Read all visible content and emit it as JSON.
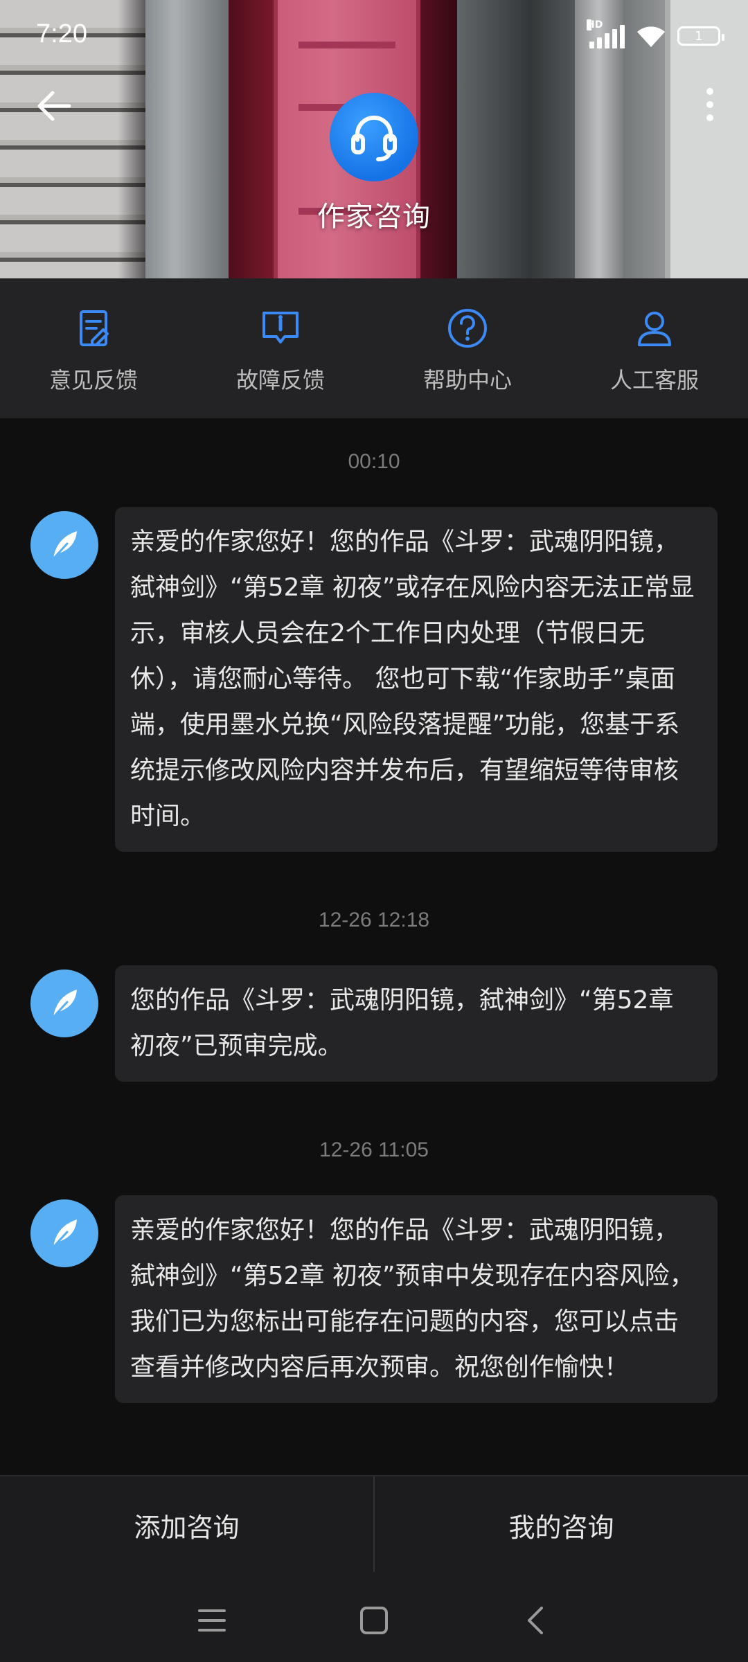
{
  "status_bar": {
    "time": "7:20",
    "network_label": "HD",
    "battery_level": "1"
  },
  "header": {
    "title": "作家咨询",
    "avatar_icon": "headset-icon",
    "back_icon": "arrow-left-icon",
    "more_icon": "more-vertical-icon"
  },
  "actions": [
    {
      "label": "意见反馈",
      "icon": "edit-note-icon"
    },
    {
      "label": "故障反馈",
      "icon": "alert-message-icon"
    },
    {
      "label": "帮助中心",
      "icon": "help-circle-icon"
    },
    {
      "label": "人工客服",
      "icon": "person-icon"
    }
  ],
  "accent_color": "#3b8af5",
  "messages": [
    {
      "time": "00:10",
      "text": "亲爱的作家您好！您的作品《斗罗：武魂阴阳镜，弑神剑》“第52章 初夜”或存在风险内容无法正常显示，审核人员会在2个工作日内处理（节假日无休），请您耐心等待。 您也可下载“作家助手”桌面端，使用墨水兑换“风险段落提醒”功能，您基于系统提示修改风险内容并发布后，有望缩短等待审核时间。"
    },
    {
      "time": "12-26 12:18",
      "text": "您的作品《斗罗：武魂阴阳镜，弑神剑》“第52章 初夜”已预审完成。"
    },
    {
      "time": "12-26 11:05",
      "text": "亲爱的作家您好！您的作品《斗罗：武魂阴阳镜，弑神剑》“第52章 初夜”预审中发现存在内容风险，我们已为您标出可能存在问题的内容，您可以点击查看并修改内容后再次预审。祝您创作愉快！"
    }
  ],
  "bottom": {
    "add_label": "添加咨询",
    "mine_label": "我的咨询"
  },
  "nav": {
    "menu_icon": "menu-icon",
    "home_icon": "square-home-icon",
    "back_icon": "chevron-left-icon"
  }
}
